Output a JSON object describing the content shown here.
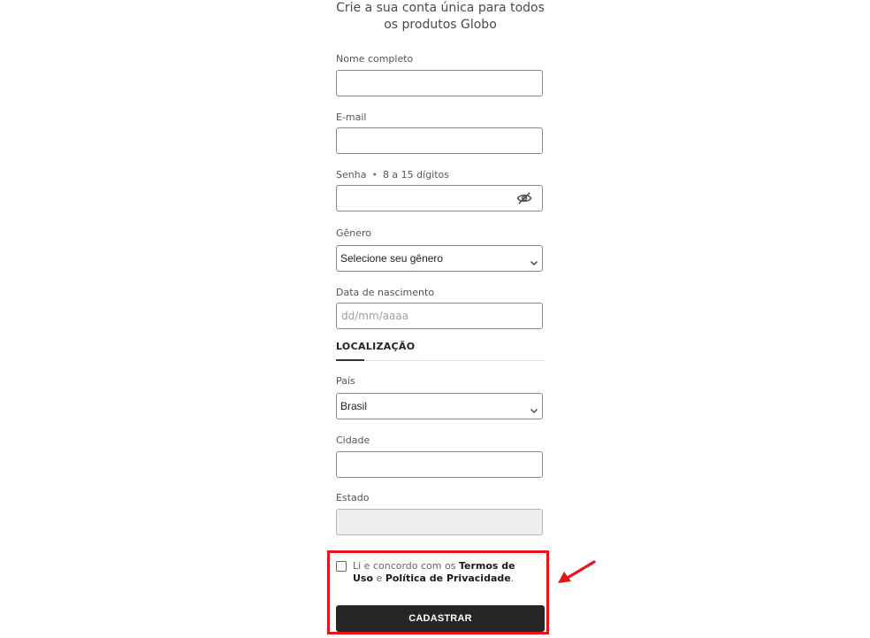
{
  "header": {
    "title_line1": "Crie a sua conta única para todos",
    "title_line2": "os produtos Globo"
  },
  "form": {
    "nome": {
      "label": "Nome completo",
      "value": ""
    },
    "email": {
      "label": "E-mail",
      "value": ""
    },
    "senha": {
      "label": "Senha",
      "hint": "8 a 15 dígitos",
      "value": "",
      "toggle_icon": "eye-slash-icon"
    },
    "genero": {
      "label": "Gênero",
      "selected": "Selecione seu gênero"
    },
    "nascimento": {
      "label": "Data de nascimento",
      "placeholder": "dd/mm/aaaa"
    },
    "localizacao": {
      "section_title": "LOCALIZAÇÃO",
      "pais": {
        "label": "País",
        "selected": "Brasil"
      },
      "cidade": {
        "label": "Cidade",
        "value": ""
      },
      "estado": {
        "label": "Estado",
        "value": ""
      }
    },
    "terms": {
      "prefix": "Li e concordo com os ",
      "link1": "Termos de Uso",
      "middle": " e ",
      "link2": "Política de Privacidade",
      "suffix": ".",
      "checked": false
    },
    "submit_label": "CADASTRAR"
  },
  "annotation": {
    "highlight_color": "#e8141b",
    "arrow_color": "#e8141b"
  }
}
